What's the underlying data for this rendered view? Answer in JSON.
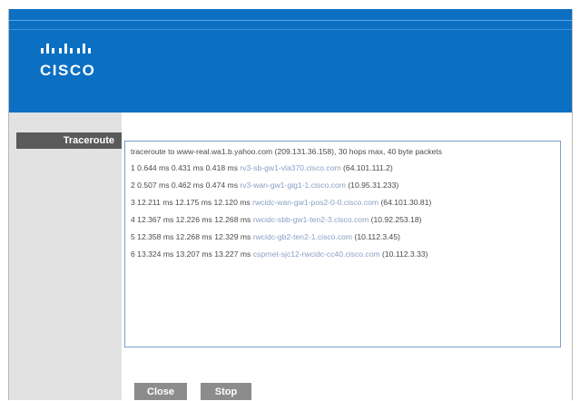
{
  "brand": {
    "logo_text": "CISCO"
  },
  "sidebar": {
    "active_label": "Traceroute"
  },
  "output": {
    "header": "traceroute to www-real.wa1.b.yahoo.com (209.131.36.158), 30 hops max, 40 byte packets",
    "hops": [
      {
        "prefix": "1 0.644 ms 0.431 ms 0.418 ms ",
        "host": "rv3-sb-gw1-vla370.cisco.com",
        "suffix": " (64.101.111.2)"
      },
      {
        "prefix": "2 0.507 ms 0.462 ms 0.474 ms ",
        "host": "rv3-wan-gw1-gig1-1.cisco.com",
        "suffix": " (10.95.31.233)"
      },
      {
        "prefix": "3 12.211 ms 12.175 ms 12.120 ms ",
        "host": "rwcidc-wan-gw1-pos2-0-0.cisco.com",
        "suffix": " (64.101.30.81)"
      },
      {
        "prefix": "4 12.367 ms 12.226 ms 12.268 ms ",
        "host": "rwcidc-sbb-gw1-ten2-3.cisco.com",
        "suffix": " (10.92.253.18)"
      },
      {
        "prefix": "5 12.358 ms 12.268 ms 12.329 ms ",
        "host": "rwcidc-gb2-ten2-1.cisco.com",
        "suffix": " (10.112.3.45)"
      },
      {
        "prefix": "6 13.324 ms 13.207 ms 13.227 ms ",
        "host": "csprnet-sjc12-rwcidc-cc40.cisco.com",
        "suffix": " (10.112.3.33)"
      }
    ]
  },
  "buttons": {
    "close_label": "Close",
    "stop_label": "Stop"
  },
  "colors": {
    "banner": "#0b6fc2",
    "sidebar": "#e2e2e2",
    "tab": "#5a5a5a",
    "button": "#8c8c8c"
  }
}
